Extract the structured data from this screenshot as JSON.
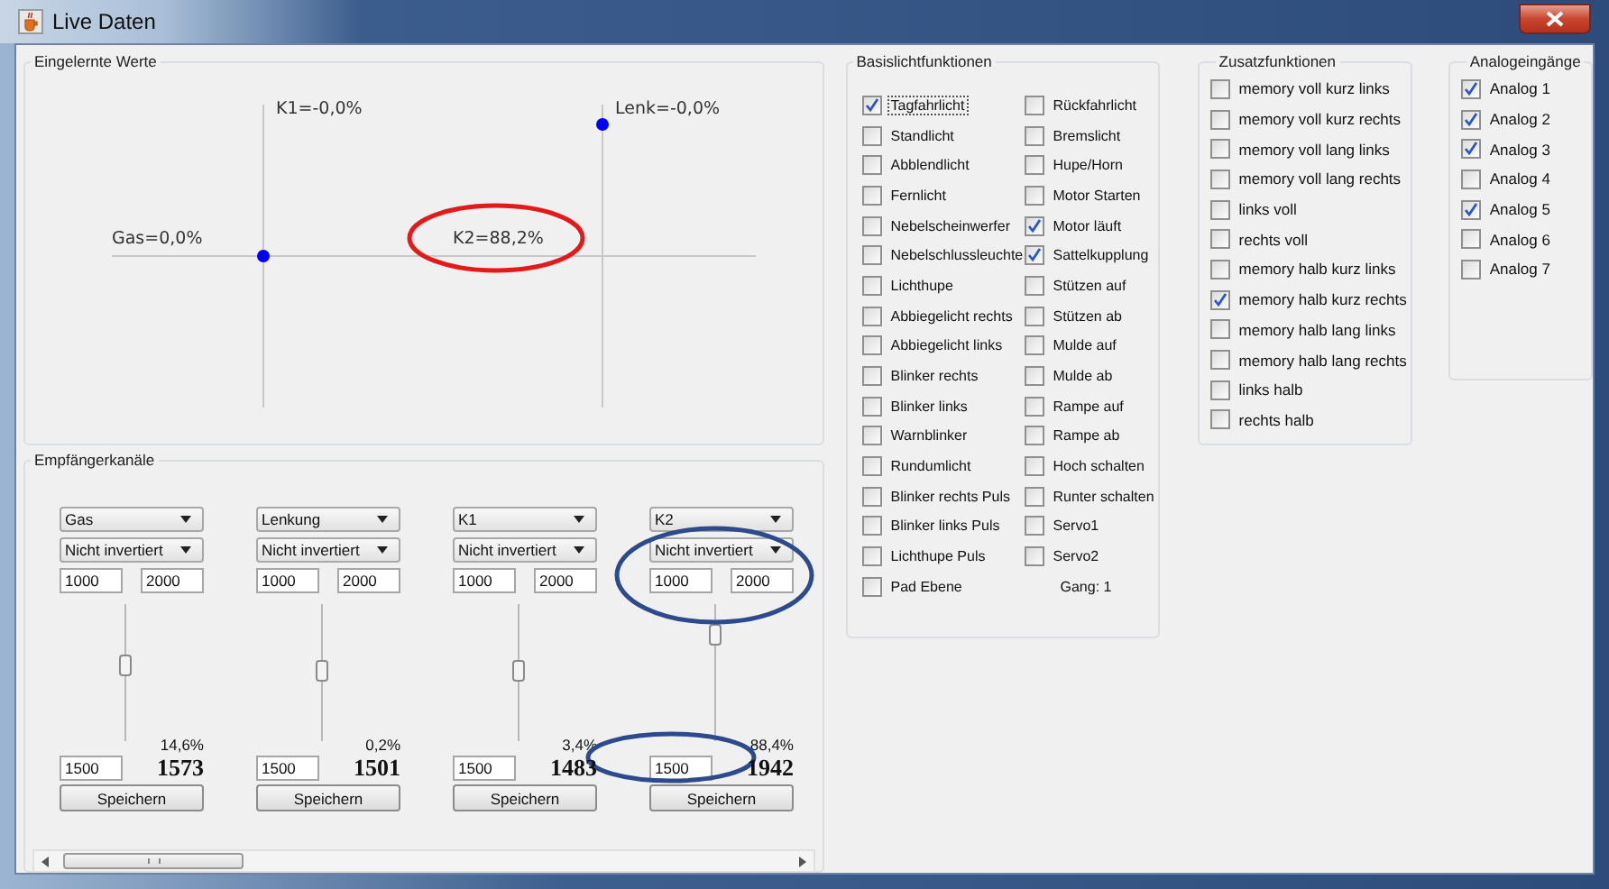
{
  "window": {
    "title": "Live Daten"
  },
  "value_display": {
    "title": "Eingelernte Werte",
    "labels": [
      {
        "kind": "gas",
        "text": "Gas=0,0%",
        "circled": false
      },
      {
        "kind": "k1",
        "text": "K1=-0,0%",
        "circled": false
      },
      {
        "kind": "lenk",
        "text": "Lenk=-0,0%",
        "circled": false
      },
      {
        "kind": "k2",
        "text": "K2=88,2%",
        "circled": true
      }
    ]
  },
  "receiver_channels": {
    "title": "Empfängerkanäle",
    "channels": [
      {
        "source": "Gas",
        "inversion": "Nicht invertiert",
        "min": "1000",
        "max": "2000",
        "level": 0.55,
        "percent": "14,6%",
        "value": "1573",
        "center": "1500",
        "button": "Speichern",
        "circled_settings": false,
        "circled_center": false
      },
      {
        "source": "Lenkung",
        "inversion": "Nicht invertiert",
        "min": "1000",
        "max": "2000",
        "level": 0.5,
        "percent": "0,2%",
        "value": "1501",
        "center": "1500",
        "button": "Speichern",
        "circled_settings": false,
        "circled_center": false
      },
      {
        "source": "K1",
        "inversion": "Nicht invertiert",
        "min": "1000",
        "max": "2000",
        "level": 0.5,
        "percent": "3,4%",
        "value": "1483",
        "center": "1500",
        "button": "Speichern",
        "circled_settings": false,
        "circled_center": false
      },
      {
        "source": "K2",
        "inversion": "Nicht invertiert",
        "min": "1000",
        "max": "2000",
        "level": 0.8,
        "percent": "88,4%",
        "value": "1942",
        "center": "1500",
        "button": "Speichern",
        "circled_settings": true,
        "circled_center": true
      }
    ]
  },
  "basic_lights": {
    "title": "Basislichtfunktionen",
    "column_1": [
      {
        "label": "Tagfahrlicht",
        "checked": true,
        "focused": true
      },
      {
        "label": "Standlicht",
        "checked": false,
        "focused": false
      },
      {
        "label": "Abblendlicht",
        "checked": false,
        "focused": false
      },
      {
        "label": "Fernlicht",
        "checked": false,
        "focused": false
      },
      {
        "label": "Nebelscheinwerfer",
        "checked": false,
        "focused": false
      },
      {
        "label": "Nebelschlussleuchte",
        "checked": false,
        "focused": false
      },
      {
        "label": "Lichthupe",
        "checked": false,
        "focused": false
      },
      {
        "label": "Abbiegelicht rechts",
        "checked": false,
        "focused": false
      },
      {
        "label": "Abbiegelicht links",
        "checked": false,
        "focused": false
      },
      {
        "label": "Blinker rechts",
        "checked": false,
        "focused": false
      },
      {
        "label": "Blinker links",
        "checked": false,
        "focused": false
      },
      {
        "label": "Warnblinker",
        "checked": false,
        "focused": false
      },
      {
        "label": "Rundumlicht",
        "checked": false,
        "focused": false
      },
      {
        "label": "Blinker rechts Puls",
        "checked": false,
        "focused": false
      },
      {
        "label": "Blinker links Puls",
        "checked": false,
        "focused": false
      },
      {
        "label": "Lichthupe Puls",
        "checked": false,
        "focused": false
      },
      {
        "label": "Pad Ebene",
        "checked": false,
        "focused": false
      }
    ],
    "column_2": [
      {
        "label": "Rückfahrlicht",
        "checked": false,
        "focused": false
      },
      {
        "label": "Bremslicht",
        "checked": false,
        "focused": false
      },
      {
        "label": "Hupe/Horn",
        "checked": false,
        "focused": false
      },
      {
        "label": "Motor Starten",
        "checked": false,
        "focused": false
      },
      {
        "label": "Motor läuft",
        "checked": true,
        "focused": false
      },
      {
        "label": "Sattelkupplung",
        "checked": true,
        "focused": false
      },
      {
        "label": "Stützen auf",
        "checked": false,
        "focused": false
      },
      {
        "label": "Stützen ab",
        "checked": false,
        "focused": false
      },
      {
        "label": "Mulde auf",
        "checked": false,
        "focused": false
      },
      {
        "label": "Mulde ab",
        "checked": false,
        "focused": false
      },
      {
        "label": "Rampe auf",
        "checked": false,
        "focused": false
      },
      {
        "label": "Rampe ab",
        "checked": false,
        "focused": false
      },
      {
        "label": "Hoch schalten",
        "checked": false,
        "focused": false
      },
      {
        "label": "Runter schalten",
        "checked": false,
        "focused": false
      },
      {
        "label": "Servo1",
        "checked": false,
        "focused": false
      },
      {
        "label": "Servo2",
        "checked": false,
        "focused": false
      }
    ],
    "gear": "Gang: 1"
  },
  "extra_functions": {
    "title": "Zusatzfunktionen",
    "items": [
      {
        "label": "memory voll kurz links",
        "checked": false
      },
      {
        "label": "memory voll kurz rechts",
        "checked": false
      },
      {
        "label": "memory voll lang links",
        "checked": false
      },
      {
        "label": "memory voll lang rechts",
        "checked": false
      },
      {
        "label": "links voll",
        "checked": false
      },
      {
        "label": "rechts voll",
        "checked": false
      },
      {
        "label": "memory halb kurz links",
        "checked": false
      },
      {
        "label": "memory halb kurz rechts",
        "checked": true
      },
      {
        "label": "memory halb lang links",
        "checked": false
      },
      {
        "label": "memory halb lang rechts",
        "checked": false
      },
      {
        "label": "links halb",
        "checked": false
      },
      {
        "label": "rechts halb",
        "checked": false
      }
    ]
  },
  "analog_inputs": {
    "title": "Analogeingänge",
    "items": [
      {
        "label": "Analog 1",
        "checked": true
      },
      {
        "label": "Analog 2",
        "checked": true
      },
      {
        "label": "Analog 3",
        "checked": true
      },
      {
        "label": "Analog 4",
        "checked": false
      },
      {
        "label": "Analog 5",
        "checked": true
      },
      {
        "label": "Analog 6",
        "checked": false
      },
      {
        "label": "Analog 7",
        "checked": false
      }
    ]
  }
}
